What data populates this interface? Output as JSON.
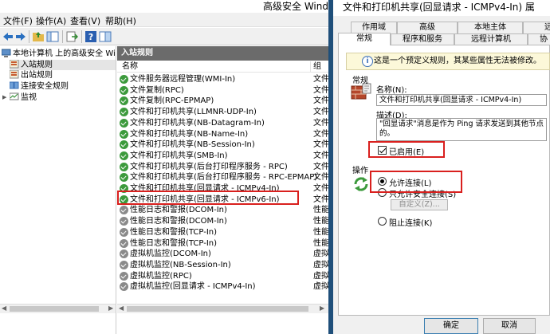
{
  "main_window": {
    "title": "高级安全 Wind",
    "menu": [
      "文件(F)",
      "操作(A)",
      "查看(V)",
      "帮助(H)"
    ],
    "tree": {
      "root": "本地计算机 上的高级安全 Wind",
      "items": [
        "入站规则",
        "出站规则",
        "连接安全规则",
        "监视"
      ]
    },
    "list": {
      "header": "入站规则",
      "col_name": "名称",
      "col_group": "组",
      "rows": [
        {
          "name": "文件服务器远程管理(WMI-In)",
          "group": "文件",
          "enabled": true
        },
        {
          "name": "文件复制(RPC)",
          "group": "文件",
          "enabled": true
        },
        {
          "name": "文件复制(RPC-EPMAP)",
          "group": "文件",
          "enabled": true
        },
        {
          "name": "文件和打印机共享(LLMNR-UDP-In)",
          "group": "文件",
          "enabled": true
        },
        {
          "name": "文件和打印机共享(NB-Datagram-In)",
          "group": "文件",
          "enabled": true
        },
        {
          "name": "文件和打印机共享(NB-Name-In)",
          "group": "文件",
          "enabled": true
        },
        {
          "name": "文件和打印机共享(NB-Session-In)",
          "group": "文件",
          "enabled": true
        },
        {
          "name": "文件和打印机共享(SMB-In)",
          "group": "文件",
          "enabled": true
        },
        {
          "name": "文件和打印机共享(后台打印程序服务 - RPC)",
          "group": "文件",
          "enabled": true
        },
        {
          "name": "文件和打印机共享(后台打印程序服务 - RPC-EPMAP)",
          "group": "文件",
          "enabled": true
        },
        {
          "name": "文件和打印机共享(回显请求 - ICMPv4-In)",
          "group": "文件",
          "enabled": true
        },
        {
          "name": "文件和打印机共享(回显请求 - ICMPv6-In)",
          "group": "文件",
          "enabled": true
        },
        {
          "name": "性能日志和警报(DCOM-In)",
          "group": "性能",
          "enabled": false
        },
        {
          "name": "性能日志和警报(DCOM-In)",
          "group": "性能",
          "enabled": false
        },
        {
          "name": "性能日志和警报(TCP-In)",
          "group": "性能",
          "enabled": false
        },
        {
          "name": "性能日志和警报(TCP-In)",
          "group": "性能",
          "enabled": false
        },
        {
          "name": "虚拟机监控(DCOM-In)",
          "group": "虚拟",
          "enabled": false
        },
        {
          "name": "虚拟机监控(NB-Session-In)",
          "group": "虚拟",
          "enabled": false
        },
        {
          "name": "虚拟机监控(RPC)",
          "group": "虚拟",
          "enabled": false
        },
        {
          "name": "虚拟机监控(回显请求 - ICMPv4-In)",
          "group": "虚拟",
          "enabled": false
        }
      ]
    }
  },
  "dialog": {
    "title": "文件和打印机共享(回显请求 - ICMPv4-In) 属",
    "tabs_row1": [
      "作用域",
      "高级",
      "本地主体",
      "远"
    ],
    "tabs_row2": [
      "常规",
      "程序和服务",
      "远程计算机",
      "协"
    ],
    "info_text": "这是一个预定义规则，其某些属性无法被修改。",
    "section_general": "常规",
    "name_label": "名称(N):",
    "name_value": "文件和打印机共享(回显请求 - ICMPv4-In)",
    "desc_label": "描述(D):",
    "desc_value": "\"回显请求\"消息是作为 Ping 请求发送到其他节点的。",
    "enabled_label": "已启用(E)",
    "section_action": "操作",
    "allow_label": "允许连接(L)",
    "allow_secure_label": "只允许安全连接(S)",
    "customize_label": "自定义(Z)...",
    "block_label": "阻止连接(K)",
    "ok_label": "确定",
    "cancel_label": "取消"
  },
  "colors": {
    "highlight_box": "#d9201e",
    "header_bar": "#6b6b6b",
    "enabled_icon": "#3c9a3c",
    "disabled_icon": "#8a8a8a"
  }
}
